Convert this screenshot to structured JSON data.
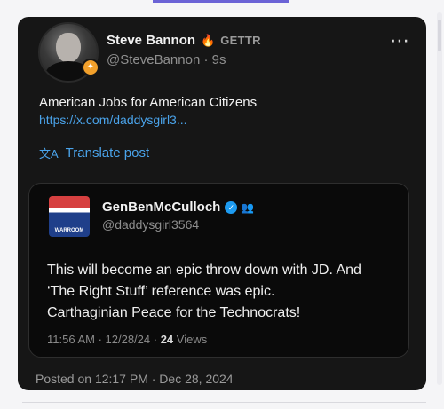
{
  "post": {
    "author": {
      "display_name": "Steve Bannon",
      "source_tag": "GETTR",
      "handle": "@SteveBannon",
      "time_ago": "9s",
      "flame_icon": "🔥",
      "badge_icon": "✦"
    },
    "more_icon": "⋯",
    "text": "American Jobs for American Citizens",
    "link": "https://x.com/daddysgirl3...",
    "translate_label": "Translate post",
    "translate_icon": "文A"
  },
  "quote": {
    "display_name": "GenBenMcCulloch",
    "verified_icon": "✓",
    "affiliation_icon": "👥",
    "handle": "@daddysgirl3564",
    "avatar_text": "WARROOM",
    "lines": [
      "This will become an epic throw down with JD.  And",
      "‘The Right Stuff’ reference was epic.",
      "Carthaginian Peace for the Technocrats!"
    ],
    "timestamp": "11:56 AM · 12/28/24 ·",
    "views_count": "24",
    "views_label": "Views"
  },
  "posted_on": "Posted on 12:17 PM · Dec 28, 2024",
  "colors": {
    "card_bg": "#161616",
    "link": "#4aa3ea",
    "accent": "#6b63d6"
  }
}
